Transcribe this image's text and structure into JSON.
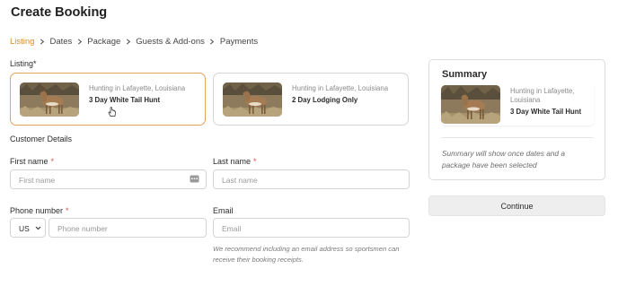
{
  "page": {
    "title": "Create Booking"
  },
  "breadcrumb": {
    "steps": [
      {
        "label": "Listing",
        "active": true
      },
      {
        "label": "Dates",
        "active": false
      },
      {
        "label": "Package",
        "active": false
      },
      {
        "label": "Guests & Add-ons",
        "active": false
      },
      {
        "label": "Payments",
        "active": false
      }
    ]
  },
  "listing": {
    "label": "Listing",
    "required_mark": "*",
    "cards": [
      {
        "location": "Hunting in Lafayette, Louisiana",
        "name": "3 Day White Tail Hunt",
        "selected": true
      },
      {
        "location": "Hunting in Lafayette, Louisiana",
        "name": "2 Day Lodging Only",
        "selected": false
      }
    ]
  },
  "customer": {
    "section_title": "Customer Details",
    "first_name": {
      "label": "First name",
      "required": "*",
      "placeholder": "First name"
    },
    "last_name": {
      "label": "Last name",
      "required": "*",
      "placeholder": "Last name"
    },
    "phone": {
      "label": "Phone number",
      "required": "*",
      "country_code": "US",
      "placeholder": "Phone number"
    },
    "email": {
      "label": "Email",
      "placeholder": "Email",
      "note": "We recommend including an email address so sportsmen can receive their booking receipts."
    }
  },
  "summary": {
    "title": "Summary",
    "item": {
      "location": "Hunting in Lafayette, Louisiana",
      "name": "3 Day White Tail Hunt"
    },
    "note": "Summary will show once dates and a package have been selected"
  },
  "actions": {
    "continue_label": "Continue"
  },
  "colors": {
    "accent": "#d98b2b",
    "selected_border": "#e6a15b",
    "required": "#d9534f"
  }
}
